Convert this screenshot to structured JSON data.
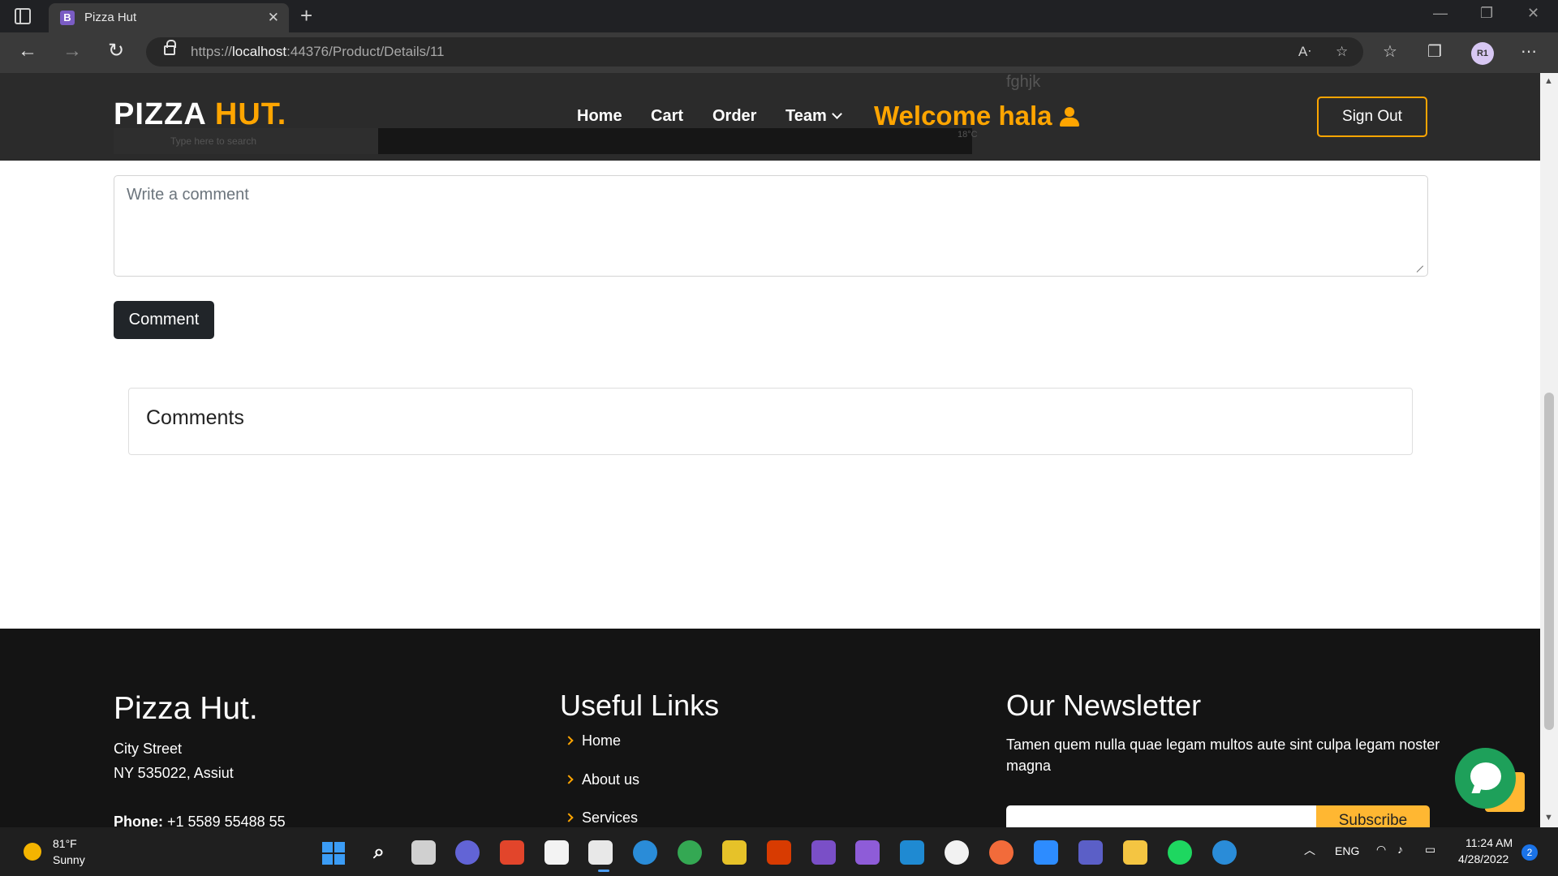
{
  "browser": {
    "tab_title": "Pizza Hut",
    "tab_favicon_letter": "B",
    "url_scheme": "https://",
    "url_host": "localhost",
    "url_path": ":44376/Product/Details/11",
    "profile_initials": "R1"
  },
  "header": {
    "logo_main": "PIZZA",
    "logo_accent": "HUT.",
    "nav": [
      "Home",
      "Cart",
      "Order",
      "Team"
    ],
    "welcome": "Welcome hala",
    "signout": "Sign Out",
    "overlay_taskbar_search": "Type here to search",
    "overlay_tag": "18°C",
    "overlay_text": "fghjk"
  },
  "main": {
    "comment_placeholder": "Write a comment",
    "comment_button": "Comment",
    "comments_title": "Comments"
  },
  "footer": {
    "brand": "Pizza Hut.",
    "address_line1": "City Street",
    "address_line2": "NY 535022, Assiut",
    "phone_label": "Phone:",
    "phone_value": "+1 5589 55488 55",
    "links_heading": "Useful Links",
    "links": [
      "Home",
      "About us",
      "Services"
    ],
    "newsletter_heading": "Our Newsletter",
    "newsletter_text": "Tamen quem nulla quae legam multos aute sint culpa legam noster magna",
    "subscribe": "Subscribe"
  },
  "taskbar": {
    "weather_temp": "81°F",
    "weather_desc": "Sunny",
    "lang": "ENG",
    "time": "11:24 AM",
    "date": "4/28/2022",
    "notifications": "2"
  },
  "colors": {
    "accent": "#ffa500",
    "header_bg": "#2b2b2b",
    "footer_bg": "#141414",
    "button_dark": "#212529",
    "chat_green": "#1ea05a"
  }
}
